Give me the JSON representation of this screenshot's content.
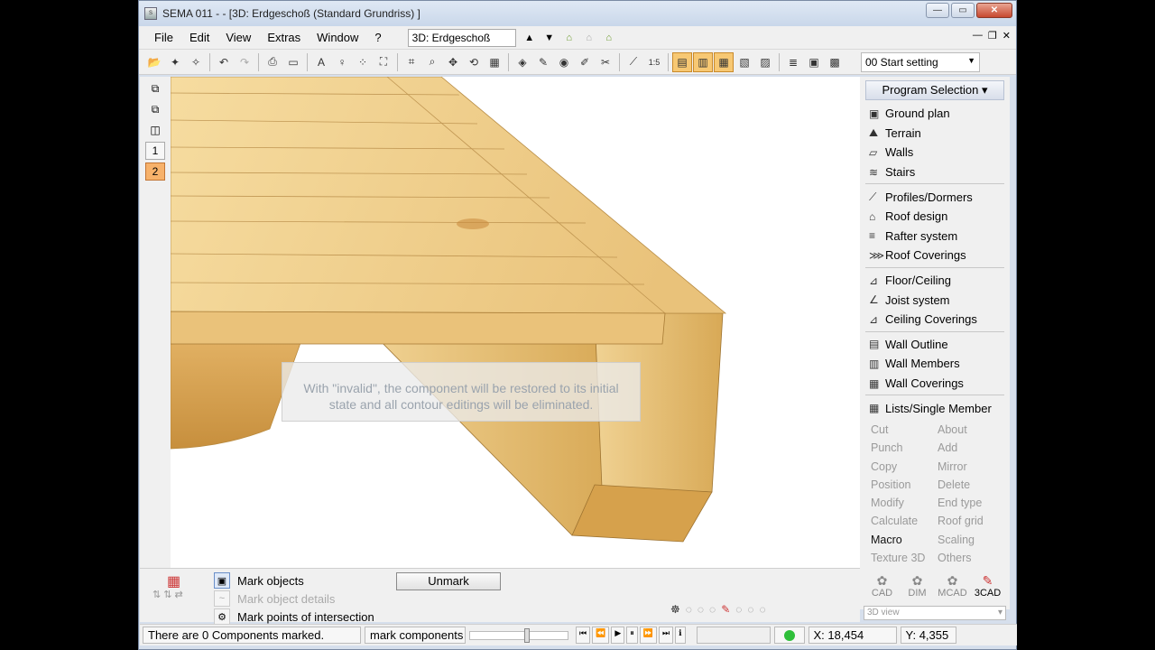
{
  "window": {
    "title": "SEMA  011 -   - [3D: Erdgeschoß (Standard Grundriss) ]"
  },
  "menu": {
    "items": [
      "File",
      "Edit",
      "View",
      "Extras",
      "Window",
      "?"
    ],
    "view_select": "3D: Erdgeschoß"
  },
  "toolbar": {
    "start_setting": "00 Start setting"
  },
  "left_strip": {
    "layer1": "1",
    "layer2": "2"
  },
  "viewport": {
    "tooltip_line1": "With \"invalid\", the component will be restored to its initial",
    "tooltip_line2": "state and all contour editings will be eliminated."
  },
  "program_selection": {
    "header": "Program Selection",
    "groups": [
      [
        {
          "label": "Ground plan",
          "icon": "ground-plan-icon"
        },
        {
          "label": "Terrain",
          "icon": "terrain-icon"
        },
        {
          "label": "Walls",
          "icon": "walls-icon"
        },
        {
          "label": "Stairs",
          "icon": "stairs-icon"
        }
      ],
      [
        {
          "label": "Profiles/Dormers",
          "icon": "profiles-icon"
        },
        {
          "label": "Roof design",
          "icon": "roof-design-icon"
        },
        {
          "label": "Rafter system",
          "icon": "rafter-icon"
        },
        {
          "label": "Roof Coverings",
          "icon": "roof-coverings-icon"
        }
      ],
      [
        {
          "label": "Floor/Ceiling",
          "icon": "floor-icon"
        },
        {
          "label": "Joist system",
          "icon": "joist-icon"
        },
        {
          "label": "Ceiling Coverings",
          "icon": "ceiling-icon"
        }
      ],
      [
        {
          "label": "Wall Outline",
          "icon": "wall-outline-icon"
        },
        {
          "label": "Wall Members",
          "icon": "wall-members-icon"
        },
        {
          "label": "Wall Coverings",
          "icon": "wall-coverings-icon"
        }
      ],
      [
        {
          "label": "Lists/Single Member",
          "icon": "lists-icon"
        }
      ]
    ]
  },
  "edit_commands": [
    {
      "label": "Cut",
      "enabled": false
    },
    {
      "label": "About",
      "enabled": false
    },
    {
      "label": "Punch",
      "enabled": false
    },
    {
      "label": "Add",
      "enabled": false
    },
    {
      "label": "Copy",
      "enabled": false
    },
    {
      "label": "Mirror",
      "enabled": false
    },
    {
      "label": "Position",
      "enabled": false
    },
    {
      "label": "Delete",
      "enabled": false
    },
    {
      "label": "Modify",
      "enabled": false
    },
    {
      "label": "End type",
      "enabled": false
    },
    {
      "label": "Calculate",
      "enabled": false
    },
    {
      "label": "Roof grid",
      "enabled": false
    },
    {
      "label": "Macro",
      "enabled": true
    },
    {
      "label": "Scaling",
      "enabled": false
    },
    {
      "label": "Texture 3D",
      "enabled": false
    },
    {
      "label": "Others",
      "enabled": false
    }
  ],
  "modes": [
    {
      "label": "CAD",
      "active": false
    },
    {
      "label": "DIM",
      "active": false
    },
    {
      "label": "MCAD",
      "active": false
    },
    {
      "label": "3CAD",
      "active": true
    }
  ],
  "view_dropdown": "3D view",
  "mark_options": {
    "mark_objects": "Mark objects",
    "mark_object_details": "Mark object details",
    "mark_points": "Mark points of intersection",
    "unmark": "Unmark"
  },
  "status": {
    "message": "There are 0 Components marked.",
    "mode": "mark components",
    "x": "X: 18,454",
    "y": "Y: 4,355"
  },
  "colors": {
    "accent_orange": "#f7b26b",
    "wood_light": "#f2cf86",
    "wood_dark": "#d7a64f"
  }
}
